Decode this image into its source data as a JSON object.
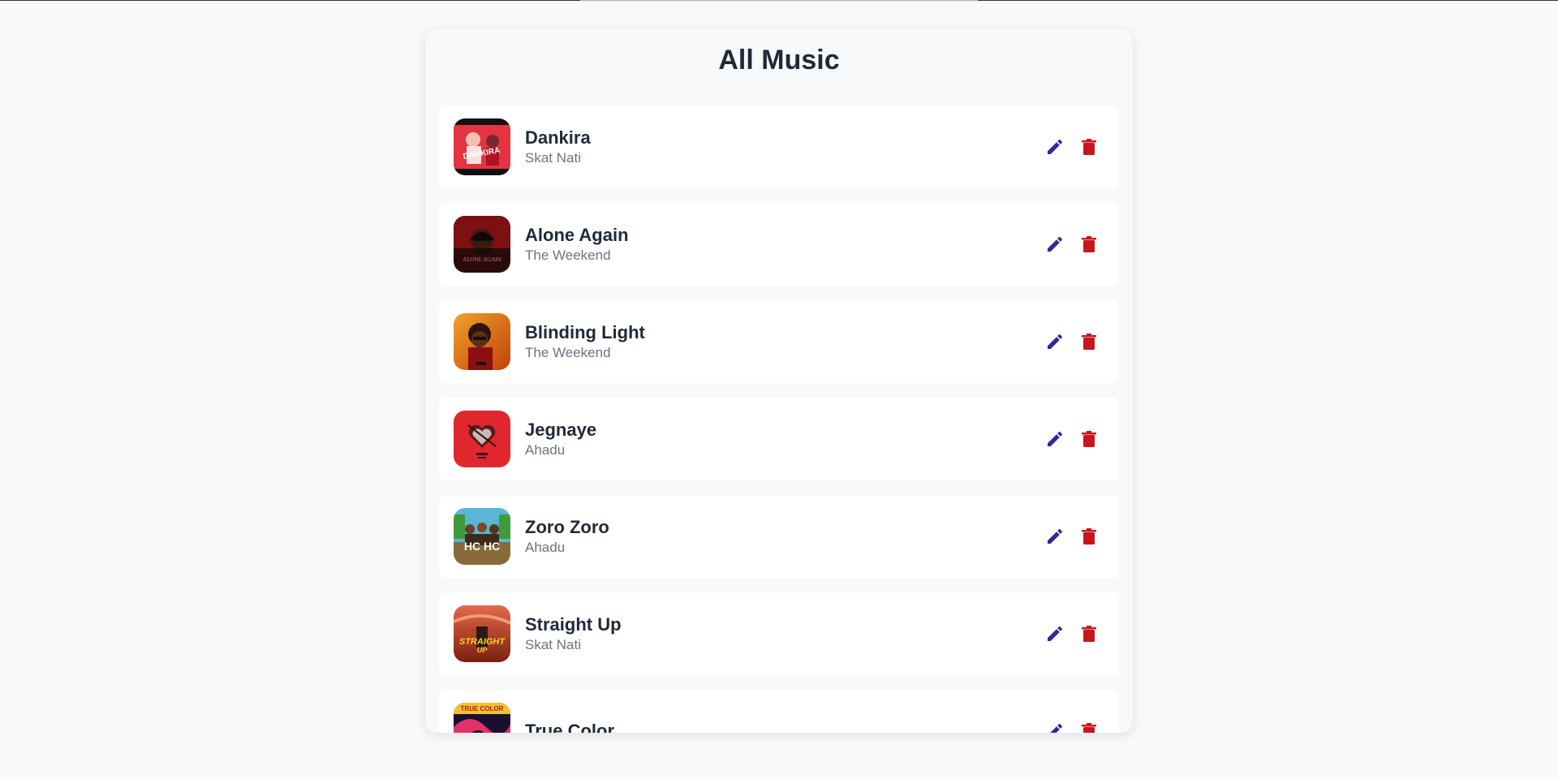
{
  "page": {
    "title": "All Music"
  },
  "colors": {
    "edit": "#2e2a96",
    "delete": "#c8161d",
    "background": "#f8f9fa"
  },
  "songs": [
    {
      "title": "Dankira",
      "artist": "Skat Nati"
    },
    {
      "title": "Alone Again",
      "artist": "The Weekend"
    },
    {
      "title": "Blinding Light",
      "artist": "The Weekend"
    },
    {
      "title": "Jegnaye",
      "artist": "Ahadu"
    },
    {
      "title": "Zoro Zoro",
      "artist": "Ahadu"
    },
    {
      "title": "Straight Up",
      "artist": "Skat Nati"
    },
    {
      "title": "True Color",
      "artist": ""
    }
  ],
  "icons": {
    "edit": "pencil-icon",
    "delete": "trash-icon"
  }
}
